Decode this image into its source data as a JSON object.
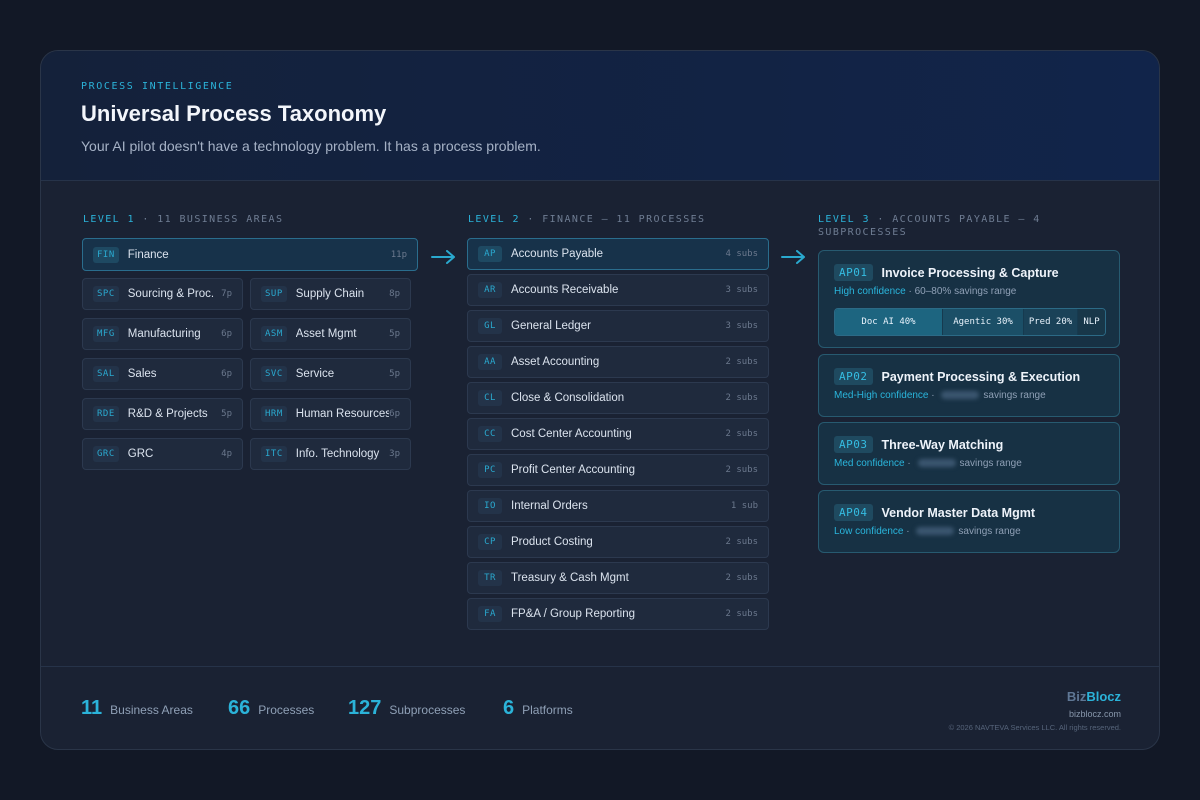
{
  "header": {
    "eyebrow": "PROCESS INTELLIGENCE",
    "title": "Universal Process Taxonomy",
    "subtitle": "Your AI pilot doesn't have a technology problem. It has a process problem."
  },
  "level1": {
    "level": "LEVEL 1",
    "desc": " · 11 BUSINESS AREAS",
    "active": {
      "code": "FIN",
      "label": "Finance",
      "count": "11p"
    },
    "items": [
      {
        "code": "SPC",
        "label": "Sourcing & Proc.",
        "count": "7p"
      },
      {
        "code": "SUP",
        "label": "Supply Chain",
        "count": "8p"
      },
      {
        "code": "MFG",
        "label": "Manufacturing",
        "count": "6p"
      },
      {
        "code": "ASM",
        "label": "Asset Mgmt",
        "count": "5p"
      },
      {
        "code": "SAL",
        "label": "Sales",
        "count": "6p"
      },
      {
        "code": "SVC",
        "label": "Service",
        "count": "5p"
      },
      {
        "code": "RDE",
        "label": "R&D & Projects",
        "count": "5p"
      },
      {
        "code": "HRM",
        "label": "Human Resources",
        "count": "6p"
      },
      {
        "code": "GRC",
        "label": "GRC",
        "count": "4p"
      },
      {
        "code": "ITC",
        "label": "Info. Technology",
        "count": "3p"
      }
    ]
  },
  "level2": {
    "level": "LEVEL 2",
    "desc": " · FINANCE — 11 PROCESSES",
    "items": [
      {
        "code": "AP",
        "label": "Accounts Payable",
        "count": "4 subs"
      },
      {
        "code": "AR",
        "label": "Accounts Receivable",
        "count": "3 subs"
      },
      {
        "code": "GL",
        "label": "General Ledger",
        "count": "3 subs"
      },
      {
        "code": "AA",
        "label": "Asset Accounting",
        "count": "2 subs"
      },
      {
        "code": "CL",
        "label": "Close & Consolidation",
        "count": "2 subs"
      },
      {
        "code": "CC",
        "label": "Cost Center Accounting",
        "count": "2 subs"
      },
      {
        "code": "PC",
        "label": "Profit Center Accounting",
        "count": "2 subs"
      },
      {
        "code": "IO",
        "label": "Internal Orders",
        "count": "1 sub"
      },
      {
        "code": "CP",
        "label": "Product Costing",
        "count": "2 subs"
      },
      {
        "code": "TR",
        "label": "Treasury & Cash Mgmt",
        "count": "2 subs"
      },
      {
        "code": "FA",
        "label": "FP&A / Group Reporting",
        "count": "2 subs"
      }
    ]
  },
  "level3": {
    "level": "LEVEL 3",
    "desc_line1": " · ACCOUNTS PAYABLE — 4",
    "desc_line2": "SUBPROCESSES",
    "items": [
      {
        "code": "AP01",
        "name": "Invoice Processing & Capture",
        "confidence": "High confidence",
        "sep": " · ",
        "range": "60–80% savings range",
        "platforms": [
          {
            "label": "Doc AI 40%",
            "share": 40,
            "color": "#1d6580"
          },
          {
            "label": "Agentic 30%",
            "share": 30,
            "color": "#1b4f67"
          },
          {
            "label": "Pred 20%",
            "share": 20,
            "color": "#1a4258"
          },
          {
            "label": "NLP",
            "share": 10,
            "color": "#183749"
          }
        ]
      },
      {
        "code": "AP02",
        "name": "Payment Processing & Execution",
        "confidence": "Med-High confidence",
        "sep": " · ",
        "range": "savings range"
      },
      {
        "code": "AP03",
        "name": "Three-Way Matching",
        "confidence": "Med confidence",
        "sep": " · ",
        "range": "savings range"
      },
      {
        "code": "AP04",
        "name": "Vendor Master Data Mgmt",
        "confidence": "Low confidence",
        "sep": " · ",
        "range": "savings range"
      }
    ]
  },
  "footer": {
    "stats": [
      {
        "n": "11",
        "label": "Business Areas"
      },
      {
        "n": "66",
        "label": "Processes"
      },
      {
        "n": "127",
        "label": "Subprocesses"
      },
      {
        "n": "6",
        "label": "Platforms"
      }
    ],
    "brand_1": "Biz",
    "brand_2": "Blocz",
    "url": "bizblocz.com",
    "copyright": "© 2026 NAVTEVA Services LLC. All rights reserved."
  },
  "colors": {
    "accent": "#2bb3d9",
    "background": "#121826",
    "card": "#1a2233"
  }
}
